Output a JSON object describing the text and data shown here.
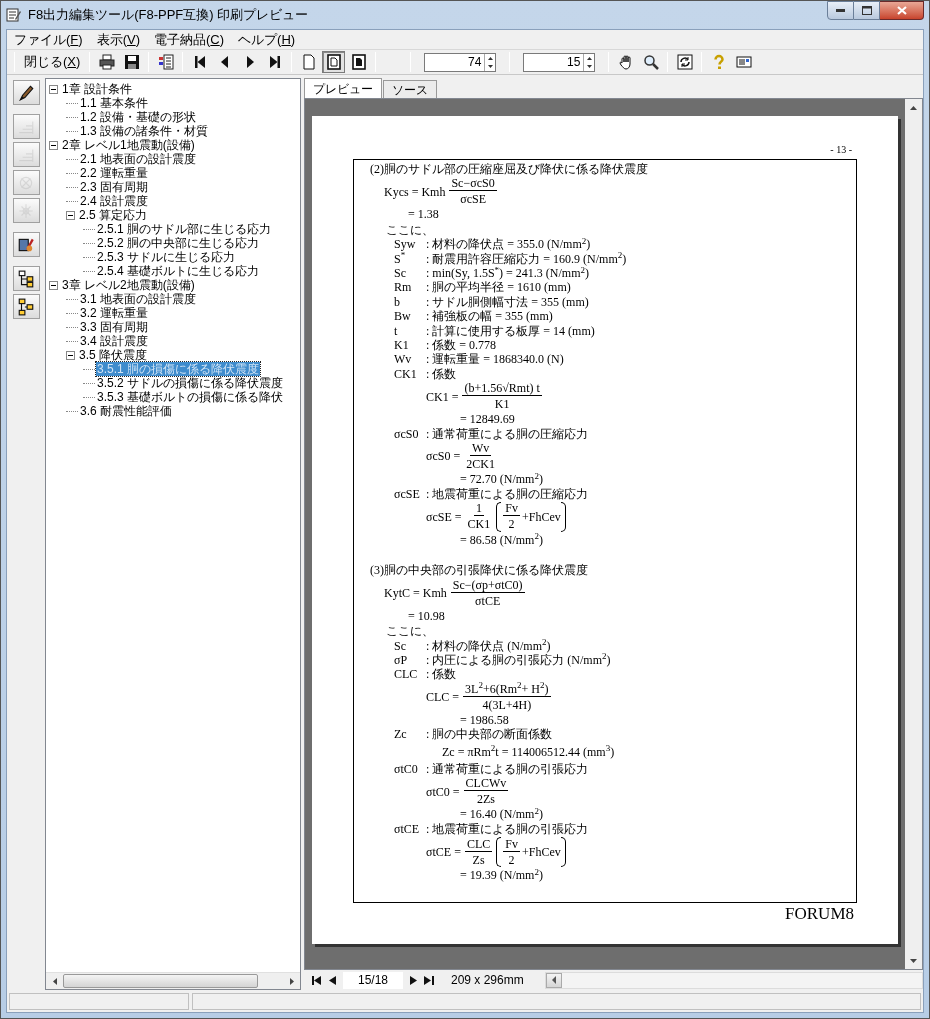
{
  "window": {
    "title": "F8出力編集ツール(F8-PPF互換) 印刷プレビュー"
  },
  "menu": [
    "ファイル(F)",
    "表示(V)",
    "電子納品(C)",
    "ヘルプ(H)"
  ],
  "toolbar": {
    "close_label": "閉じる(X)",
    "view_buttons": [
      {
        "selected": false
      },
      {
        "selected": true
      },
      {
        "selected": false
      }
    ],
    "zoom": "74",
    "page": "15"
  },
  "side_tools": [
    {
      "disabled": false
    },
    {
      "disabled": true
    },
    {
      "disabled": true
    },
    {
      "disabled": true
    },
    {
      "disabled": true
    },
    {
      "disabled": false
    },
    {
      "disabled": false
    },
    {
      "disabled": false
    }
  ],
  "tree": [
    {
      "label": "1章 設計条件",
      "expanded": true,
      "selected": false,
      "children": [
        {
          "label": "1.1 基本条件",
          "selected": false
        },
        {
          "label": "1.2 設備・基礎の形状",
          "selected": false
        },
        {
          "label": "1.3 設備の諸条件・材質",
          "selected": false
        }
      ]
    },
    {
      "label": "2章 レベル1地震動(設備)",
      "expanded": true,
      "selected": false,
      "children": [
        {
          "label": "2.1 地表面の設計震度",
          "selected": false
        },
        {
          "label": "2.2 運転重量",
          "selected": false
        },
        {
          "label": "2.3 固有周期",
          "selected": false
        },
        {
          "label": "2.4 設計震度",
          "selected": false
        },
        {
          "label": "2.5 算定応力",
          "expanded": true,
          "selected": false,
          "children": [
            {
              "label": "2.5.1 胴のサドル部に生じる応力",
              "selected": false
            },
            {
              "label": "2.5.2 胴の中央部に生じる応力",
              "selected": false
            },
            {
              "label": "2.5.3 サドルに生じる応力",
              "selected": false
            },
            {
              "label": "2.5.4 基礎ボルトに生じる応力",
              "selected": false
            }
          ]
        }
      ]
    },
    {
      "label": "3章 レベル2地震動(設備)",
      "expanded": true,
      "selected": false,
      "children": [
        {
          "label": "3.1 地表面の設計震度",
          "selected": false
        },
        {
          "label": "3.2 運転重量",
          "selected": false
        },
        {
          "label": "3.3 固有周期",
          "selected": false
        },
        {
          "label": "3.4 設計震度",
          "selected": false
        },
        {
          "label": "3.5 降伏震度",
          "expanded": true,
          "selected": false,
          "children": [
            {
              "label": "3.5.1 胴の損傷に係る降伏震度",
              "selected": true
            },
            {
              "label": "3.5.2 サドルの損傷に係る降伏震度",
              "selected": false
            },
            {
              "label": "3.5.3 基礎ボルトの損傷に係る降伏",
              "selected": false
            }
          ]
        },
        {
          "label": "3.6 耐震性能評価",
          "selected": false
        }
      ]
    }
  ],
  "tabs": [
    {
      "label": "プレビュー",
      "selected": true
    },
    {
      "label": "ソース",
      "selected": false
    }
  ],
  "page": {
    "number": "- 13 -",
    "footer": "FORUM8",
    "blocks": [
      {
        "kind": "heading",
        "text": "(2)胴のサドル部の圧縮座屈及び降伏に係る降伏震度"
      },
      {
        "kind": "main_formula",
        "lhs": "Kycs = Kmh",
        "num": "Sc−σcS0",
        "den": "σcSE",
        "result": "= 1.38"
      },
      {
        "kind": "note",
        "text": "ここに、"
      },
      {
        "kind": "def",
        "symbol": "Syw",
        "text": ": 材料の降伏点 = 355.0 (N/mm$^{2}$)"
      },
      {
        "kind": "def",
        "symbol": "S$^{*}$",
        "text": ": 耐震用許容圧縮応力 = 160.9 (N/mm$^{2}$)"
      },
      {
        "kind": "def",
        "symbol": "Sc",
        "text": ": min(Sy, 1.5S$^{*}$) = 241.3 (N/mm$^{2}$)"
      },
      {
        "kind": "def",
        "symbol": "Rm",
        "text": ": 胴の平均半径 = 1610 (mm)"
      },
      {
        "kind": "def",
        "symbol": "b",
        "text": ": サドル胴側幅寸法 = 355 (mm)"
      },
      {
        "kind": "def",
        "symbol": "Bw",
        "text": ": 補強板の幅 = 355 (mm)"
      },
      {
        "kind": "def",
        "symbol": "t",
        "text": ": 計算に使用する板厚 = 14 (mm)"
      },
      {
        "kind": "def",
        "symbol": "K1",
        "text": ": 係数 = 0.778"
      },
      {
        "kind": "def",
        "symbol": "Wv",
        "text": ": 運転重量 = 1868340.0 (N)"
      },
      {
        "kind": "def",
        "symbol": "CK1",
        "text": ": 係数"
      },
      {
        "kind": "sub_formula",
        "lhs": "CK1 =",
        "num": "(b+1.56√Rmt) t",
        "den": "K1",
        "result": "= 12849.69"
      },
      {
        "kind": "def",
        "symbol": "σcS0",
        "text": ": 通常荷重による胴の圧縮応力"
      },
      {
        "kind": "sub_formula",
        "lhs": "σcS0 =",
        "num": "Wv",
        "den": "2CK1",
        "result": "= 72.70 (N/mm$^{2}$)"
      },
      {
        "kind": "def",
        "symbol": "σcSE",
        "text": ": 地震荷重による胴の圧縮応力"
      },
      {
        "kind": "sub_formula",
        "lhs": "σcSE =",
        "num": "1",
        "den": "CK1",
        "paren": {
          "num": "Fv",
          "den": "2",
          "tail": "+FhCev"
        },
        "result": "= 86.58 (N/mm$^{2}$)"
      },
      {
        "kind": "heading",
        "text": "(3)胴の中央部の引張降伏に係る降伏震度"
      },
      {
        "kind": "main_formula",
        "lhs": "KytC = Kmh",
        "num": "Sc−(σp+σtC0)",
        "den": "σtCE",
        "result": "= 10.98"
      },
      {
        "kind": "note",
        "text": "ここに、"
      },
      {
        "kind": "def",
        "symbol": "Sc",
        "text": ": 材料の降伏点 (N/mm$^{2}$)"
      },
      {
        "kind": "def",
        "symbol": "σP",
        "text": ": 内圧による胴の引張応力 (N/mm$^{2}$)"
      },
      {
        "kind": "def",
        "symbol": "CLC",
        "text": ": 係数"
      },
      {
        "kind": "sub_formula",
        "lhs": "CLC =",
        "num": "3L$^{2}$+6(Rm$^{2}$+ H$^{2}$)",
        "den": "4(3L+4H)",
        "result": "= 1986.58"
      },
      {
        "kind": "def",
        "symbol": "Zc",
        "text": ": 胴の中央部の断面係数"
      },
      {
        "kind": "sub_line",
        "text": "Zc = πRm$^{2}$t = 114006512.44 (mm$^{3}$)"
      },
      {
        "kind": "def",
        "symbol": "σtC0",
        "text": ": 通常荷重による胴の引張応力"
      },
      {
        "kind": "sub_formula",
        "lhs": "σtC0 =",
        "num": "CLCWv",
        "den": "2Zs",
        "result": "= 16.40 (N/mm$^{2}$)"
      },
      {
        "kind": "def",
        "symbol": "σtCE",
        "text": ": 地震荷重による胴の引張応力"
      },
      {
        "kind": "sub_formula",
        "lhs": "σtCE =",
        "num": "CLC",
        "den": "Zs",
        "paren": {
          "num": "Fv",
          "den": "2",
          "tail": "+FhCev"
        },
        "result": "= 19.39 (N/mm$^{2}$)"
      }
    ]
  },
  "navigator": {
    "position": "15/18",
    "size": "209 x 296mm"
  }
}
